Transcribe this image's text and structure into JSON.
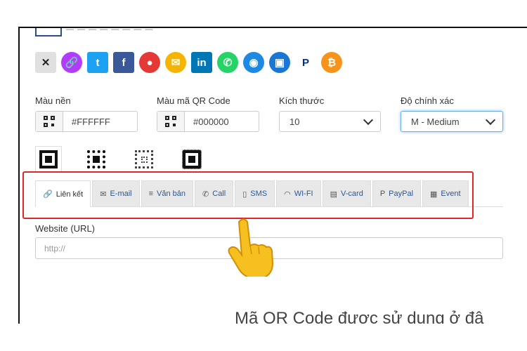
{
  "top_stub_text": "— — — — — — — —",
  "share_icons": [
    {
      "name": "close-icon",
      "glyph": "✕",
      "color": "#e0e0e0",
      "fg": "#222",
      "shape": "sq"
    },
    {
      "name": "link-icon",
      "glyph": "🔗",
      "color": "#b23cfd",
      "fg": "#fff",
      "shape": "round"
    },
    {
      "name": "twitter-icon",
      "glyph": "t",
      "color": "#1da1f2",
      "fg": "#fff",
      "shape": "sq"
    },
    {
      "name": "facebook-icon",
      "glyph": "f",
      "color": "#3b5998",
      "fg": "#fff",
      "shape": "sq"
    },
    {
      "name": "location-icon",
      "glyph": "●",
      "color": "#e53935",
      "fg": "#fff",
      "shape": "round"
    },
    {
      "name": "email-icon",
      "glyph": "✉",
      "color": "#f4b400",
      "fg": "#fff",
      "shape": "round"
    },
    {
      "name": "linkedin-icon",
      "glyph": "in",
      "color": "#0077b5",
      "fg": "#fff",
      "shape": "sq"
    },
    {
      "name": "whatsapp-icon",
      "glyph": "✆",
      "color": "#25d366",
      "fg": "#fff",
      "shape": "round"
    },
    {
      "name": "wifi-icon",
      "glyph": "◉",
      "color": "#1e88e5",
      "fg": "#fff",
      "shape": "round"
    },
    {
      "name": "vcard-icon",
      "glyph": "▣",
      "color": "#1976d2",
      "fg": "#fff",
      "shape": "round"
    },
    {
      "name": "paypal-icon",
      "glyph": "P",
      "color": "#ffffff",
      "fg": "#003087",
      "shape": "sq"
    },
    {
      "name": "bitcoin-icon",
      "glyph": "₿",
      "color": "#f7931a",
      "fg": "#fff",
      "shape": "round"
    }
  ],
  "fields": {
    "bg_label": "Màu nền",
    "bg_value": "#FFFFFF",
    "fg_label": "Màu mã QR Code",
    "fg_value": "#000000",
    "size_label": "Kích thước",
    "size_value": "10",
    "ecc_label": "Độ chính xác",
    "ecc_value": "M - Medium"
  },
  "tabs": [
    {
      "label": "Liên kết",
      "icon": "🔗",
      "icon_name": "link-icon"
    },
    {
      "label": "E-mail",
      "icon": "✉",
      "icon_name": "envelope-icon"
    },
    {
      "label": "Văn bản",
      "icon": "≡",
      "icon_name": "text-icon"
    },
    {
      "label": "Call",
      "icon": "✆",
      "icon_name": "phone-icon"
    },
    {
      "label": "SMS",
      "icon": "▯",
      "icon_name": "mobile-icon"
    },
    {
      "label": "WI-FI",
      "icon": "◠",
      "icon_name": "wifi-icon"
    },
    {
      "label": "V-card",
      "icon": "▤",
      "icon_name": "vcard-icon"
    },
    {
      "label": "PayPal",
      "icon": "P",
      "icon_name": "paypal-icon"
    },
    {
      "label": "Event",
      "icon": "▦",
      "icon_name": "calendar-icon"
    }
  ],
  "url": {
    "label": "Website (URL)",
    "placeholder": "http://"
  },
  "bottom_text": "Mã QR Code được sử dụng ở đâ",
  "accent": "#e02626"
}
